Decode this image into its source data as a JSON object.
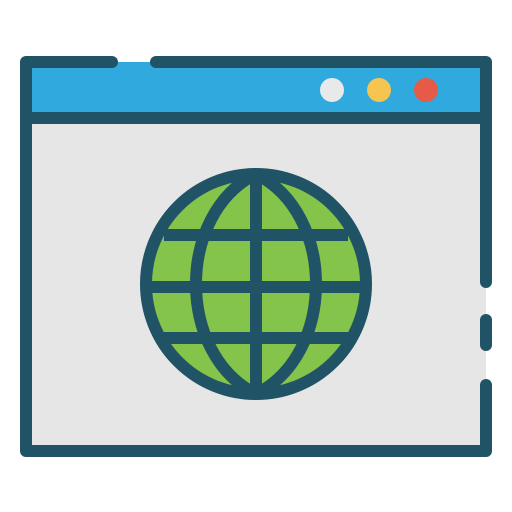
{
  "icon": {
    "name": "browser-window-globe-icon",
    "colors": {
      "outline": "#215366",
      "title_bar": "#30A9DE",
      "window_body": "#E6E6E6",
      "globe": "#84C44A",
      "dot_white": "#E9E9E9",
      "dot_yellow": "#F6C54F",
      "dot_red": "#E55B47",
      "background": "#FFFFFF"
    },
    "window_controls": [
      "white-dot",
      "yellow-dot",
      "red-dot"
    ]
  }
}
